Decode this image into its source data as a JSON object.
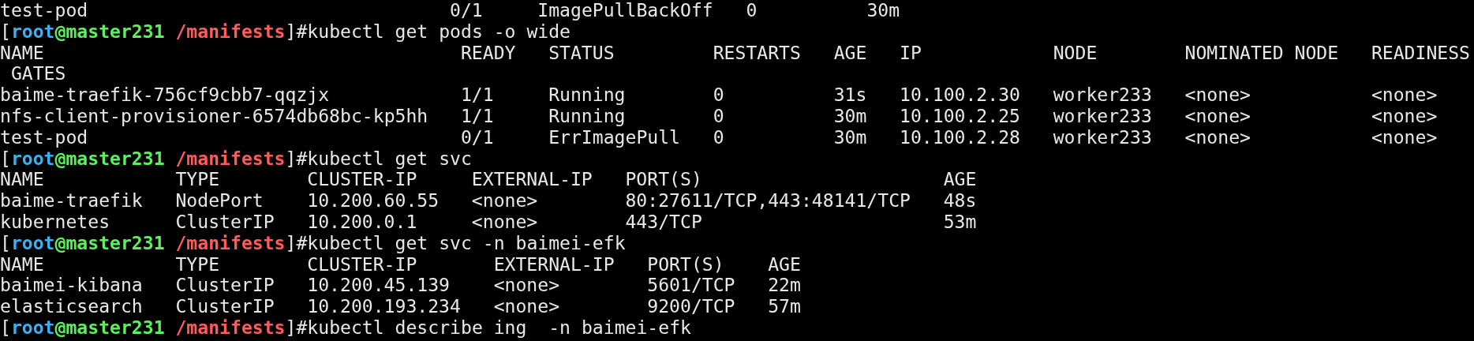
{
  "terminal": {
    "blocks": [
      {
        "kind": "line",
        "text": "test-pod                                 0/1     ImagePullBackOff   0          30m"
      },
      {
        "kind": "prompt",
        "open": "[",
        "user": "root",
        "host": "@master231",
        "path": "/manifests",
        "close": "]#",
        "command": "kubectl get pods -o wide"
      },
      {
        "kind": "table",
        "columns": [
          "NAME",
          "READY",
          "STATUS",
          "RESTARTS",
          "AGE",
          "IP",
          "NODE",
          "NOMINATED NODE",
          "READINESS"
        ],
        "header_continuation": "GATES",
        "rows": [
          [
            "baime-traefik-756cf9cbb7-qqzjx",
            "1/1",
            "Running",
            "0",
            "31s",
            "10.100.2.30",
            "worker233",
            "<none>",
            "<none>"
          ],
          [
            "nfs-client-provisioner-6574db68bc-kp5hh",
            "1/1",
            "Running",
            "0",
            "30m",
            "10.100.2.25",
            "worker233",
            "<none>",
            "<none>"
          ],
          [
            "test-pod",
            "0/1",
            "ErrImagePull",
            "0",
            "30m",
            "10.100.2.28",
            "worker233",
            "<none>",
            "<none>"
          ]
        ]
      },
      {
        "kind": "prompt",
        "open": "[",
        "user": "root",
        "host": "@master231",
        "path": "/manifests",
        "close": "]#",
        "command": "kubectl get svc"
      },
      {
        "kind": "table",
        "columns": [
          "NAME",
          "TYPE",
          "CLUSTER-IP",
          "EXTERNAL-IP",
          "PORT(S)",
          "AGE"
        ],
        "rows": [
          [
            "baime-traefik",
            "NodePort",
            "10.200.60.55",
            "<none>",
            "80:27611/TCP,443:48141/TCP",
            "48s"
          ],
          [
            "kubernetes",
            "ClusterIP",
            "10.200.0.1",
            "<none>",
            "443/TCP",
            "53m"
          ]
        ]
      },
      {
        "kind": "prompt",
        "open": "[",
        "user": "root",
        "host": "@master231",
        "path": "/manifests",
        "close": "]#",
        "command": "kubectl get svc -n baimei-efk"
      },
      {
        "kind": "table",
        "columns": [
          "NAME",
          "TYPE",
          "CLUSTER-IP",
          "EXTERNAL-IP",
          "PORT(S)",
          "AGE"
        ],
        "rows": [
          [
            "baimei-kibana",
            "ClusterIP",
            "10.200.45.139",
            "<none>",
            "5601/TCP",
            "22m"
          ],
          [
            "elasticsearch",
            "ClusterIP",
            "10.200.193.234",
            "<none>",
            "9200/TCP",
            "57m"
          ]
        ]
      },
      {
        "kind": "prompt",
        "open": "[",
        "user": "root",
        "host": "@master231",
        "path": "/manifests",
        "close": "]#",
        "command": "kubectl describe ing  -n baimei-efk"
      }
    ]
  }
}
